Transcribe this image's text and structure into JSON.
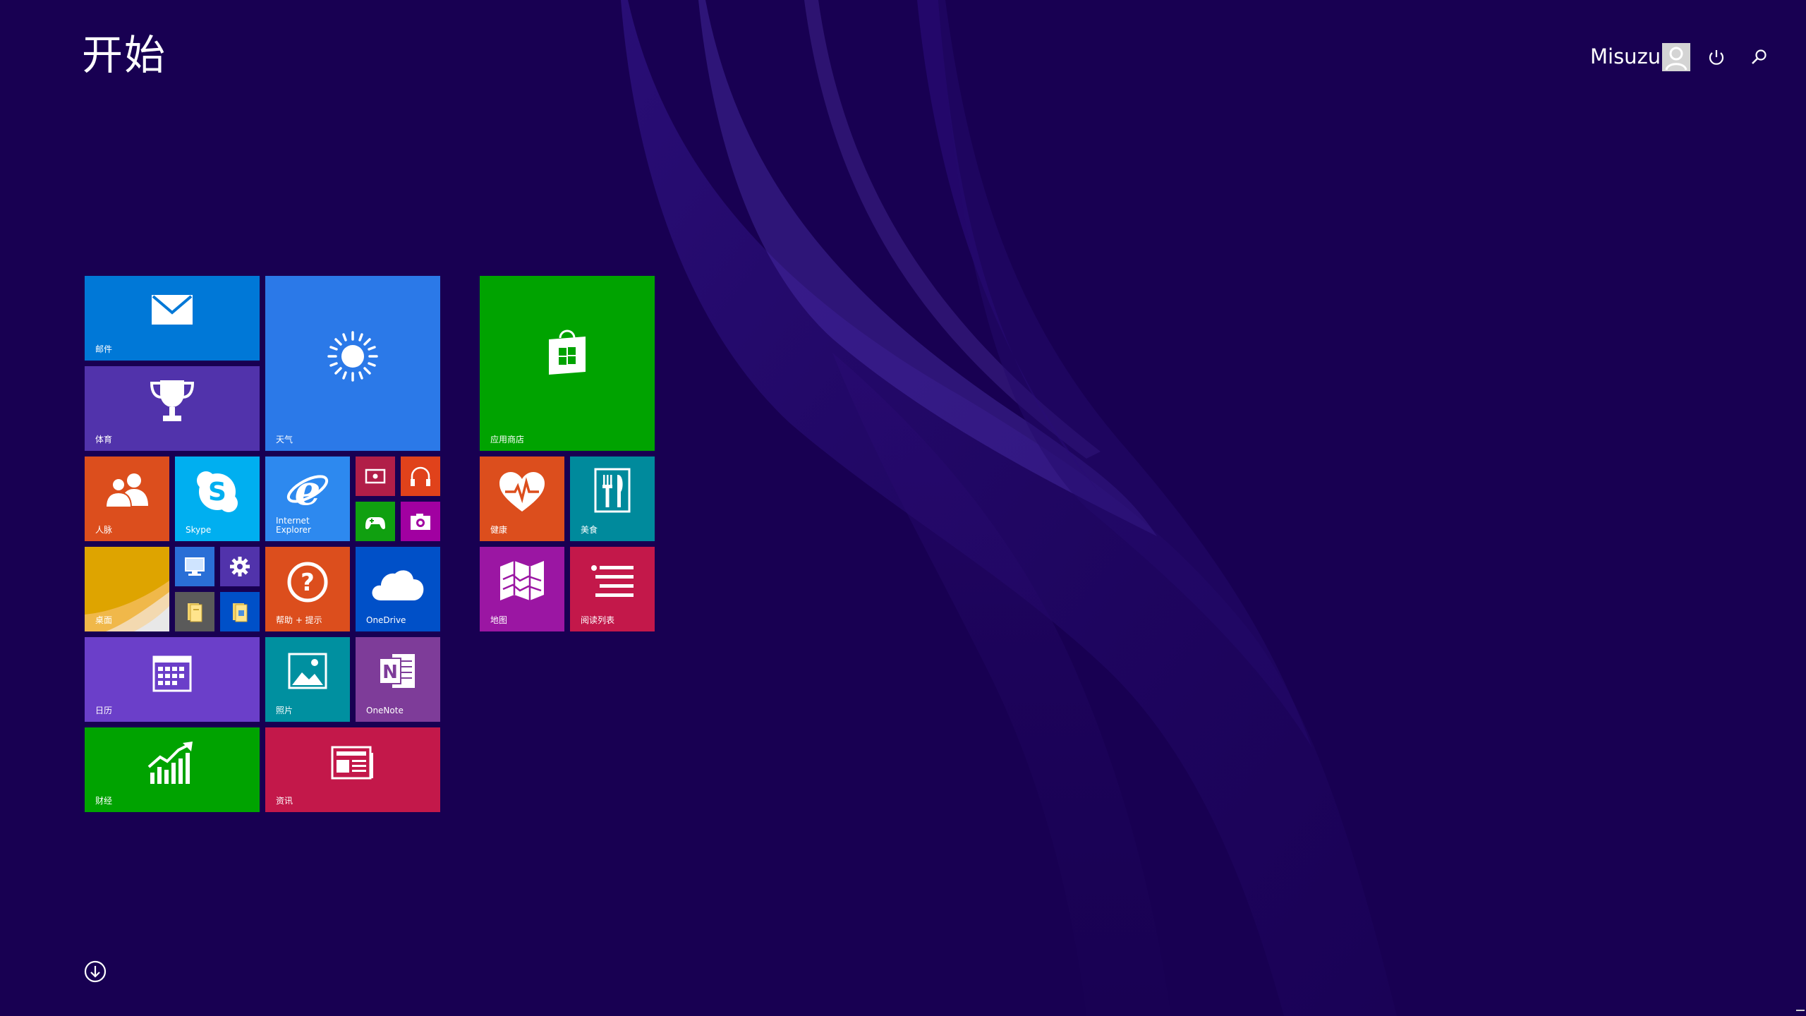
{
  "start": {
    "title": "开始"
  },
  "user": {
    "name": "Misuzu"
  },
  "icons": {
    "avatar": "user-avatar-icon",
    "power": "power-icon",
    "search": "search-icon",
    "all_apps": "down-arrow-circle-icon"
  },
  "colors": {
    "background": "#180052",
    "mail": "#0078d7",
    "sports": "#5133ab",
    "weather": "#2b79e8",
    "store": "#00a300",
    "people": "#dc4e1d",
    "skype": "#00aff0",
    "ie": "#2d89ef",
    "video": "#b11e48",
    "music": "#e0421b",
    "games": "#10a010",
    "camera": "#a100a1",
    "health": "#dc4e1d",
    "food": "#008a9c",
    "desktop": "#e0a100",
    "help": "#dc4e1d",
    "onedrive": "#0050c8",
    "maps": "#9b16a3",
    "reading": "#c3184a",
    "calendar": "#6b3fc9",
    "photos": "#0090a0",
    "onenote": "#7e3c99",
    "finance": "#00a300",
    "news": "#c3184a"
  },
  "tiles": {
    "mail": "邮件",
    "sports": "体育",
    "weather": "天气",
    "store": "应用商店",
    "people": "人脉",
    "skype": "Skype",
    "ie": "Internet\nExplorer",
    "health": "健康",
    "food": "美食",
    "desktop": "桌面",
    "help": "帮助 + 提示",
    "onedrive": "OneDrive",
    "maps": "地图",
    "reading": "阅读列表",
    "calendar": "日历",
    "photos": "照片",
    "onenote": "OneNote",
    "finance": "财经",
    "news": "资讯"
  }
}
